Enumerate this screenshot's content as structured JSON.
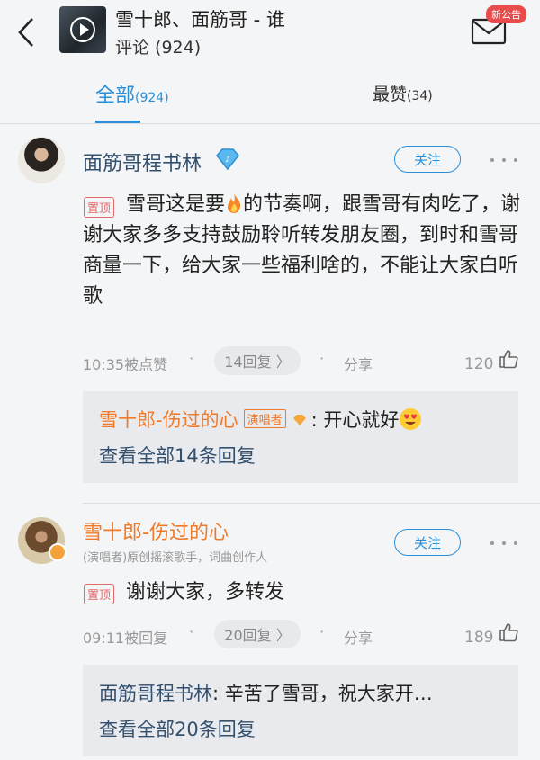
{
  "header": {
    "title": "雪十郎、面筋哥 - 谁",
    "subtitle": "评论 (924)",
    "badge": "新公告"
  },
  "tabs": {
    "all_label": "全部",
    "all_count": "(924)",
    "hot_label": "最赞",
    "hot_count": "(34)"
  },
  "comments": [
    {
      "user": "面筋哥程书林",
      "follow": "关注",
      "pin": "置顶",
      "text_a": "雪哥这是要",
      "text_b": "的节奏啊，跟雪哥有肉吃了，谢谢大家多多支持鼓励聆听转发朋友圈，到时和雪哥商量一下，给大家一些福利啥的，不能让大家白听歌",
      "time": "10:35被点赞",
      "replies": "14回复 〉",
      "share": "分享",
      "likes": "120",
      "reply_user": "雪十郎-伤过的心",
      "reply_tag": "演唱者",
      "reply_text": ": 开心就好",
      "reply_all": "查看全部14条回复"
    },
    {
      "user": "雪十郎-伤过的心",
      "desc": "(演唱者)原创摇滚歌手，词曲创作人",
      "follow": "关注",
      "pin": "置顶",
      "text": "谢谢大家，多转发",
      "time": "09:11被回复",
      "replies": "20回复 〉",
      "share": "分享",
      "likes": "189",
      "reply_user": "面筋哥程书林",
      "reply_text": ": 辛苦了雪哥，祝大家开…",
      "reply_all": "查看全部20条回复"
    }
  ],
  "colors": {
    "accent": "#2b8fd8",
    "singer": "#ee7a2a",
    "pin": "#e46a6a"
  }
}
